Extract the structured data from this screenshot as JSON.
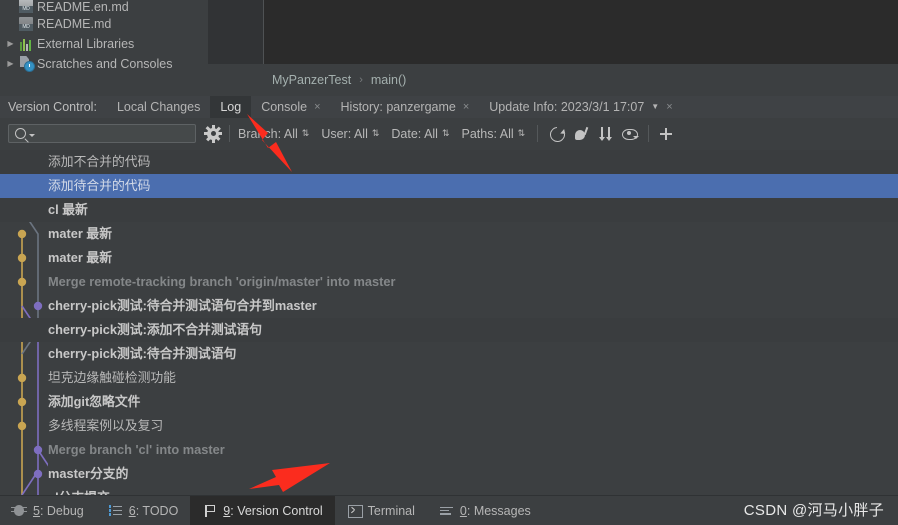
{
  "project_tree": {
    "items": [
      {
        "label": "README.en.md",
        "icon": "markdown-file-icon",
        "arrow": false,
        "partial": true
      },
      {
        "label": "README.md",
        "icon": "markdown-file-icon",
        "arrow": false,
        "partial": false
      },
      {
        "label": "External Libraries",
        "icon": "library-icon",
        "arrow": true,
        "partial": false
      },
      {
        "label": "Scratches and Consoles",
        "icon": "scratches-icon",
        "arrow": true,
        "partial": false
      }
    ]
  },
  "breadcrumb": {
    "items": [
      "MyPanzerTest",
      "main()"
    ],
    "separator": "›"
  },
  "tabbar": {
    "title": "Version Control:",
    "tabs": [
      {
        "label": "Local Changes",
        "active": false,
        "closable": false,
        "caret": false
      },
      {
        "label": "Log",
        "active": true,
        "closable": false,
        "caret": false
      },
      {
        "label": "Console",
        "active": false,
        "closable": true,
        "caret": false
      },
      {
        "label": "History: panzergame",
        "active": false,
        "closable": true,
        "caret": false
      },
      {
        "label": "Update Info: 2023/3/1 17:07",
        "active": false,
        "closable": true,
        "caret": true
      }
    ],
    "close_glyph": "×",
    "caret_glyph": "▼"
  },
  "toolbar": {
    "search_placeholder": "",
    "search_value": "",
    "search_icon": "search-icon",
    "gear_icon": "gear-icon",
    "filters": [
      {
        "label": "Branch: All"
      },
      {
        "label": "User: All"
      },
      {
        "label": "Date: All"
      },
      {
        "label": "Paths: All"
      }
    ],
    "updown_glyph": "⇅",
    "actions": [
      {
        "name": "refresh-icon",
        "label": "Refresh"
      },
      {
        "name": "cherry-pick-icon",
        "label": "Cherry-Pick"
      },
      {
        "name": "sort-icon",
        "label": "Sort"
      },
      {
        "name": "eye-icon",
        "label": "Show Details"
      },
      {
        "name": "plus-icon",
        "label": "Add"
      }
    ]
  },
  "commits": [
    {
      "message": "添加不合并的代码",
      "style": "plain",
      "row": "dark"
    },
    {
      "message": "添加待合并的代码",
      "style": "selected",
      "row": "sel"
    },
    {
      "message": "cl 最新",
      "style": "bold",
      "row": "dark"
    },
    {
      "message": "mater 最新",
      "style": "bold",
      "row": "normal"
    },
    {
      "message": "mater 最新",
      "style": "bold",
      "row": "normal"
    },
    {
      "message": "Merge remote-tracking branch 'origin/master' into master",
      "style": "merge",
      "row": "normal"
    },
    {
      "message": "cherry-pick测试:待合并测试语句合并到master",
      "style": "bold",
      "row": "normal"
    },
    {
      "message": "cherry-pick测试:添加不合并测试语句",
      "style": "bold",
      "row": "dark"
    },
    {
      "message": "cherry-pick测试:待合并测试语句",
      "style": "bold",
      "row": "normal"
    },
    {
      "message": "坦克边缘触碰检测功能",
      "style": "plain",
      "row": "normal"
    },
    {
      "message": "添加git忽略文件",
      "style": "bold",
      "row": "normal"
    },
    {
      "message": "多线程案例以及复习",
      "style": "plain",
      "row": "normal"
    },
    {
      "message": "Merge branch 'cl' into master",
      "style": "merge",
      "row": "normal"
    },
    {
      "message": "master分支的",
      "style": "bold",
      "row": "normal"
    },
    {
      "message": "cl分支提交",
      "style": "bold",
      "row": "normal"
    }
  ],
  "bottombar": {
    "items": [
      {
        "mnemonic": "5",
        "label": ": Debug",
        "icon": "bug-icon",
        "active": false
      },
      {
        "mnemonic": "6",
        "label": ": TODO",
        "icon": "todo-icon",
        "active": false
      },
      {
        "mnemonic": "9",
        "label": ": Version Control",
        "icon": "branch-icon",
        "active": true
      },
      {
        "mnemonic": "",
        "label": "Terminal",
        "icon": "terminal-icon",
        "active": false
      },
      {
        "mnemonic": "0",
        "label": ": Messages",
        "icon": "messages-icon",
        "active": false
      }
    ]
  },
  "watermark": {
    "text": "CSDN @河马小胖子"
  },
  "colors": {
    "bg": "#3c3f41",
    "editor_bg": "#2b2b2b",
    "selection": "#4b6eaf",
    "graph_tan": "#c9a552",
    "graph_purple": "#7e6ec0",
    "graph_gray": "#6b7480",
    "arrow_red": "#fb2c1e"
  }
}
